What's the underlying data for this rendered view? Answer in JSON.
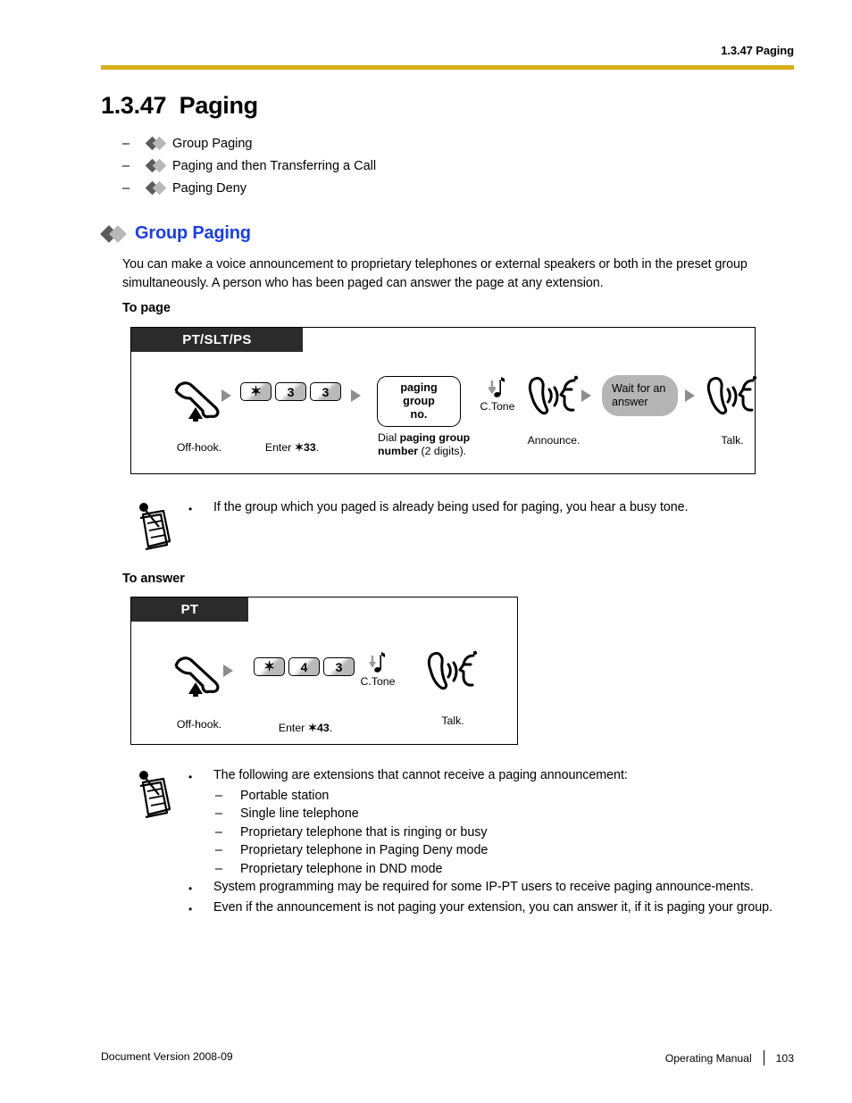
{
  "header": {
    "running_title": "1.3.47 Paging"
  },
  "accent_color": "#d4af16",
  "chapter": {
    "number": "1.3.47",
    "title": "Paging",
    "full": "1.3.47  Paging"
  },
  "toc": {
    "items": [
      {
        "dash": "–",
        "label": "Group Paging"
      },
      {
        "dash": "–",
        "label": "Paging and then Transferring a Call"
      },
      {
        "dash": "–",
        "label": "Paging Deny"
      }
    ]
  },
  "section": {
    "heading": "Group Paging",
    "heading_color": "#1a3fe0",
    "paragraph": "You can make a voice announcement to proprietary telephones or external speakers or both in the preset group simultaneously. A person who has been paged can answer the page at any extension."
  },
  "to_page": {
    "subhead": "To page",
    "device_label": "PT/SLT/PS",
    "steps": {
      "offhook_caption": "Off-hook.",
      "keys": [
        "✶",
        "3",
        "3"
      ],
      "enter_caption_prefix": "Enter ",
      "enter_caption_code": "✶33",
      "enter_caption_suffix": ".",
      "entry_box_line1": "paging group",
      "entry_box_line2": "no.",
      "dial_caption_prefix": "Dial ",
      "dial_caption_bold": "paging group number",
      "dial_caption_suffix": " (2 digits).",
      "ctone_label": "C.Tone",
      "announce_caption": "Announce.",
      "wait_line1": "Wait for an",
      "wait_line2": "answer",
      "talk_caption": "Talk."
    }
  },
  "note_1": {
    "items": [
      {
        "bullet": "•",
        "text": "If the group which you paged is already being used for paging, you hear a busy tone."
      }
    ]
  },
  "to_answer": {
    "subhead": "To answer",
    "device_label": "PT",
    "steps": {
      "offhook_caption": "Off-hook.",
      "keys": [
        "✶",
        "4",
        "3"
      ],
      "enter_caption_prefix": "Enter ",
      "enter_caption_code": "✶43",
      "enter_caption_suffix": ".",
      "ctone_label": "C.Tone",
      "talk_caption": "Talk."
    }
  },
  "note_2": {
    "item_1": {
      "bullet": "•",
      "text": "The following are extensions that cannot receive a paging announcement:"
    },
    "sub_items": [
      {
        "dash": "–",
        "text": "Portable station"
      },
      {
        "dash": "–",
        "text": "Single line telephone"
      },
      {
        "dash": "–",
        "text": "Proprietary telephone that is ringing or busy"
      },
      {
        "dash": "–",
        "text": "Proprietary telephone in Paging Deny mode"
      },
      {
        "dash": "–",
        "text": "Proprietary telephone in DND mode"
      }
    ],
    "item_2": {
      "bullet": "•",
      "text": "System programming may be required for some IP-PT users to receive paging announce-ments."
    },
    "item_3": {
      "bullet": "•",
      "text": "Even if the announcement is not paging your extension, you can answer it, if it is paging your group."
    }
  },
  "footer": {
    "document_version": "Document Version  2008-09",
    "manual_name": "Operating Manual",
    "page_number": "103"
  }
}
